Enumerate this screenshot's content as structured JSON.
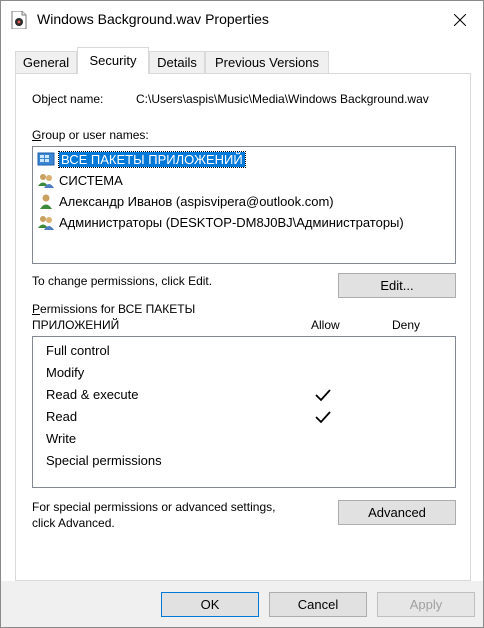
{
  "window": {
    "title": "Windows Background.wav Properties"
  },
  "tabs": [
    {
      "label": "General"
    },
    {
      "label": "Security"
    },
    {
      "label": "Details"
    },
    {
      "label": "Previous Versions"
    }
  ],
  "security": {
    "object_name_label": "Object name:",
    "object_name_value": "C:\\Users\\aspis\\Music\\Media\\Windows Background.wav",
    "group_label_first": "G",
    "group_label_rest": "roup or user names:",
    "users": [
      {
        "name": "ВСЕ ПАКЕТЫ ПРИЛОЖЕНИЙ",
        "icon": "app-packages-icon",
        "selected": true
      },
      {
        "name": "СИСТЕМА",
        "icon": "group-users-icon",
        "selected": false
      },
      {
        "name": "Александр Иванов (aspisvipera@outlook.com)",
        "icon": "user-icon",
        "selected": false
      },
      {
        "name": "Администраторы (DESKTOP-DM8J0BJ\\Администраторы)",
        "icon": "group-users-icon",
        "selected": false
      }
    ],
    "change_hint": "To change permissions, click Edit.",
    "edit_button": "Edit...",
    "permissions_for_line1": "ermissions for ВСЕ ПАКЕТЫ",
    "permissions_for_p": "P",
    "permissions_for_line2": "ПРИЛОЖЕНИЙ",
    "allow_header": "Allow",
    "deny_header": "Deny",
    "permissions": [
      {
        "name": "Full control",
        "allow": false,
        "deny": false
      },
      {
        "name": "Modify",
        "allow": false,
        "deny": false
      },
      {
        "name": "Read & execute",
        "allow": true,
        "deny": false
      },
      {
        "name": "Read",
        "allow": true,
        "deny": false
      },
      {
        "name": "Write",
        "allow": false,
        "deny": false
      },
      {
        "name": "Special permissions",
        "allow": false,
        "deny": false
      }
    ],
    "advanced_hint_line1": "For special permissions or advanced settings,",
    "advanced_hint_line2": "click Advanced.",
    "advanced_button": "Advanced"
  },
  "footer": {
    "ok": "OK",
    "cancel": "Cancel",
    "apply": "Apply"
  },
  "colors": {
    "selection": "#0078d7",
    "panel_border": "#d9d9d9"
  }
}
